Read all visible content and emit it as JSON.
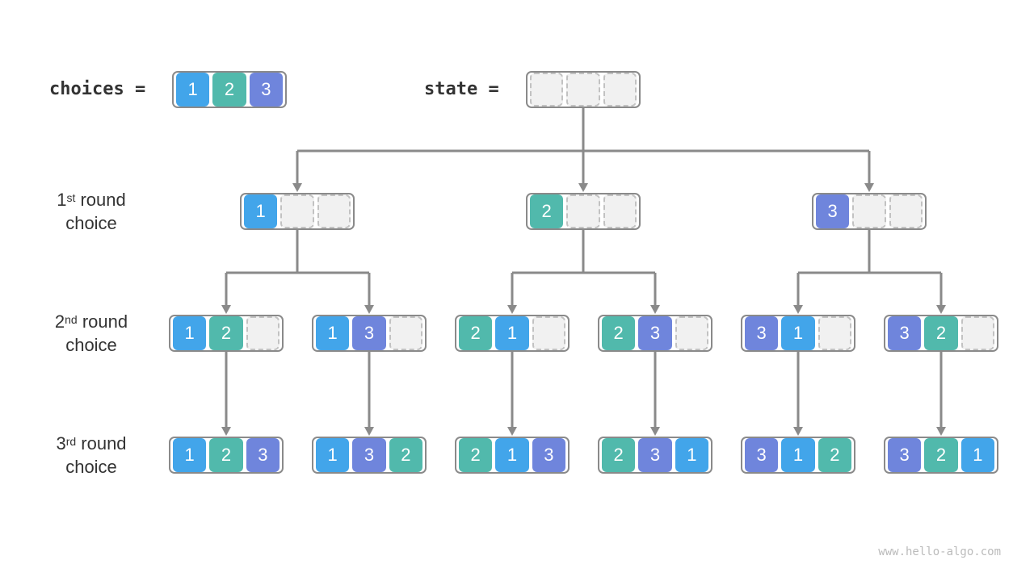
{
  "colors": {
    "1": "#42a5ea",
    "2": "#51b9ac",
    "3": "#6f85dc",
    "edge": "#8a8a8a"
  },
  "header": {
    "choices_label": "choices =",
    "state_label": "state =",
    "choices": [
      1,
      2,
      3
    ],
    "state": [
      null,
      null,
      null
    ]
  },
  "rounds": [
    {
      "num": "1",
      "sup": "st",
      "word": "round",
      "line2": "choice"
    },
    {
      "num": "2",
      "sup": "nd",
      "word": "round",
      "line2": "choice"
    },
    {
      "num": "3",
      "sup": "rd",
      "word": "round",
      "line2": "choice"
    }
  ],
  "tree": {
    "level1": [
      [
        1,
        null,
        null
      ],
      [
        2,
        null,
        null
      ],
      [
        3,
        null,
        null
      ]
    ],
    "level2": [
      [
        1,
        2,
        null
      ],
      [
        1,
        3,
        null
      ],
      [
        2,
        1,
        null
      ],
      [
        2,
        3,
        null
      ],
      [
        3,
        1,
        null
      ],
      [
        3,
        2,
        null
      ]
    ],
    "level3": [
      [
        1,
        2,
        3
      ],
      [
        1,
        3,
        2
      ],
      [
        2,
        1,
        3
      ],
      [
        2,
        3,
        1
      ],
      [
        3,
        1,
        2
      ],
      [
        3,
        2,
        1
      ]
    ]
  },
  "watermark": "www.hello-algo.com"
}
